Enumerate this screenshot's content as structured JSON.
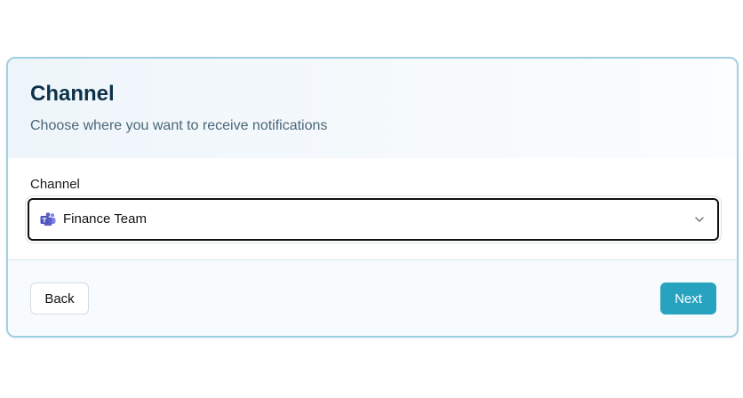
{
  "header": {
    "title": "Channel",
    "subtitle": "Choose where you want to receive notifications"
  },
  "form": {
    "channel_label": "Channel",
    "channel_select": {
      "selected_value": "Finance Team",
      "icon": "microsoft-teams-icon"
    }
  },
  "footer": {
    "back_label": "Back",
    "next_label": "Next"
  },
  "colors": {
    "accent": "#27a2bf",
    "title": "#0d3149",
    "border": "#9fcfe0",
    "teams_purple": "#5b5fc7"
  }
}
